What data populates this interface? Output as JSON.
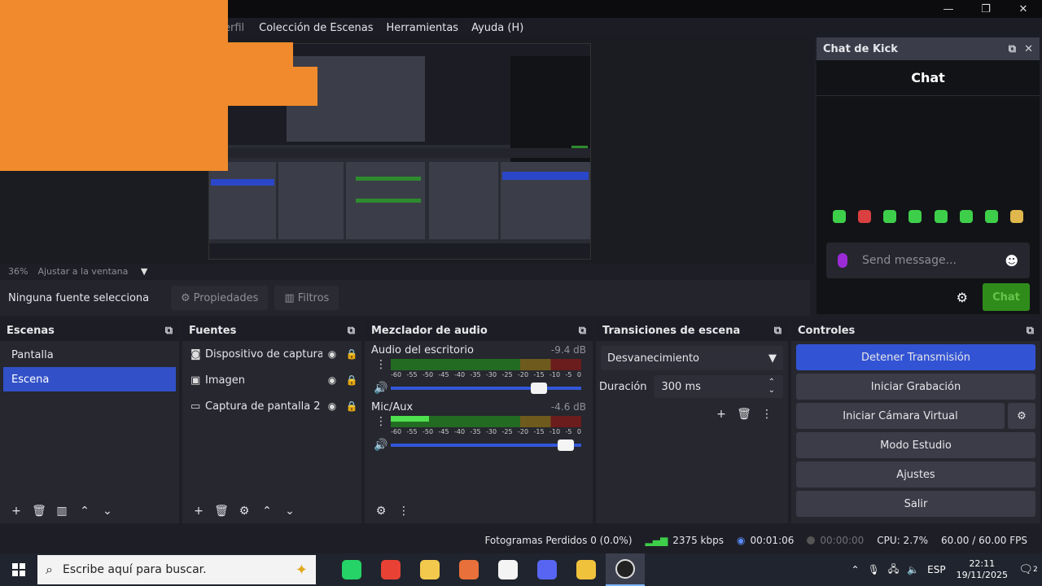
{
  "window": {
    "controls": [
      "—",
      "❐",
      "✕"
    ]
  },
  "menu": {
    "items": [
      "erfil",
      "Colección de Escenas",
      "Herramientas",
      "Ayuda (H)"
    ]
  },
  "preview": {
    "zoom": "36%",
    "fit_label": "Ajustar a la ventana"
  },
  "source_toolbar": {
    "no_source": "Ninguna fuente selecciona",
    "properties": "Propiedades",
    "filters": "Filtros"
  },
  "chat": {
    "dock_title": "Chat de Kick",
    "title": "Chat",
    "placeholder": "Send message...",
    "send_label": "Chat",
    "emote_colors": [
      "#3ecf4a",
      "#d9403f",
      "#3ecf4a",
      "#3ecf4a",
      "#3ecf4a",
      "#3ecf4a",
      "#3ecf4a",
      "#e0b74c"
    ]
  },
  "scenes": {
    "title": "Escenas",
    "items": [
      {
        "label": "Pantalla",
        "active": false
      },
      {
        "label": "Escena",
        "active": true
      }
    ]
  },
  "sources": {
    "title": "Fuentes",
    "items": [
      {
        "label": "Dispositivo de captura",
        "icon": "camera-icon"
      },
      {
        "label": "Imagen",
        "icon": "image-icon"
      },
      {
        "label": "Captura de pantalla 2",
        "icon": "monitor-icon"
      }
    ]
  },
  "mixer": {
    "title": "Mezclador de audio",
    "ticks": [
      "-60",
      "-55",
      "-50",
      "-45",
      "-40",
      "-35",
      "-30",
      "-25",
      "-20",
      "-15",
      "-10",
      "-5",
      "0"
    ],
    "channels": [
      {
        "name": "Audio del escritorio",
        "db": "-9.4 dB",
        "level": 0.0,
        "volume": 0.82
      },
      {
        "name": "Mic/Aux",
        "db": "-4.6 dB",
        "level": 0.2,
        "volume": 0.96
      }
    ]
  },
  "transitions": {
    "title": "Transiciones de escena",
    "selected": "Desvanecimiento",
    "duration_label": "Duración",
    "duration_value": "300 ms"
  },
  "controls": {
    "title": "Controles",
    "stop_stream": "Detener Transmisión",
    "start_recording": "Iniciar Grabación",
    "start_virtual_cam": "Iniciar Cámara Virtual",
    "studio_mode": "Modo Estudio",
    "settings": "Ajustes",
    "exit": "Salir"
  },
  "status": {
    "dropped_frames": "Fotogramas Perdidos 0 (0.0%)",
    "bitrate": "2375 kbps",
    "stream_time": "00:01:06",
    "rec_time": "00:00:00",
    "cpu": "CPU: 2.7%",
    "fps": "60.00 / 60.00 FPS"
  },
  "taskbar": {
    "search_placeholder": "Escribe aquí para buscar.",
    "lang": "ESP",
    "time": "22:11",
    "date": "19/11/2025",
    "notifications": "2",
    "apps": [
      {
        "name": "whatsapp-icon",
        "color": "#25d366"
      },
      {
        "name": "chrome-icon",
        "color": "#e94235"
      },
      {
        "name": "file-explorer-icon",
        "color": "#f2c94c"
      },
      {
        "name": "color-app-icon",
        "color": "#e8703a"
      },
      {
        "name": "calendar-icon",
        "color": "#f4f4f4"
      },
      {
        "name": "discord-icon",
        "color": "#5865f2"
      },
      {
        "name": "kick-app-icon",
        "color": "#f0c23c"
      },
      {
        "name": "obs-icon",
        "color": "#222222"
      }
    ]
  }
}
